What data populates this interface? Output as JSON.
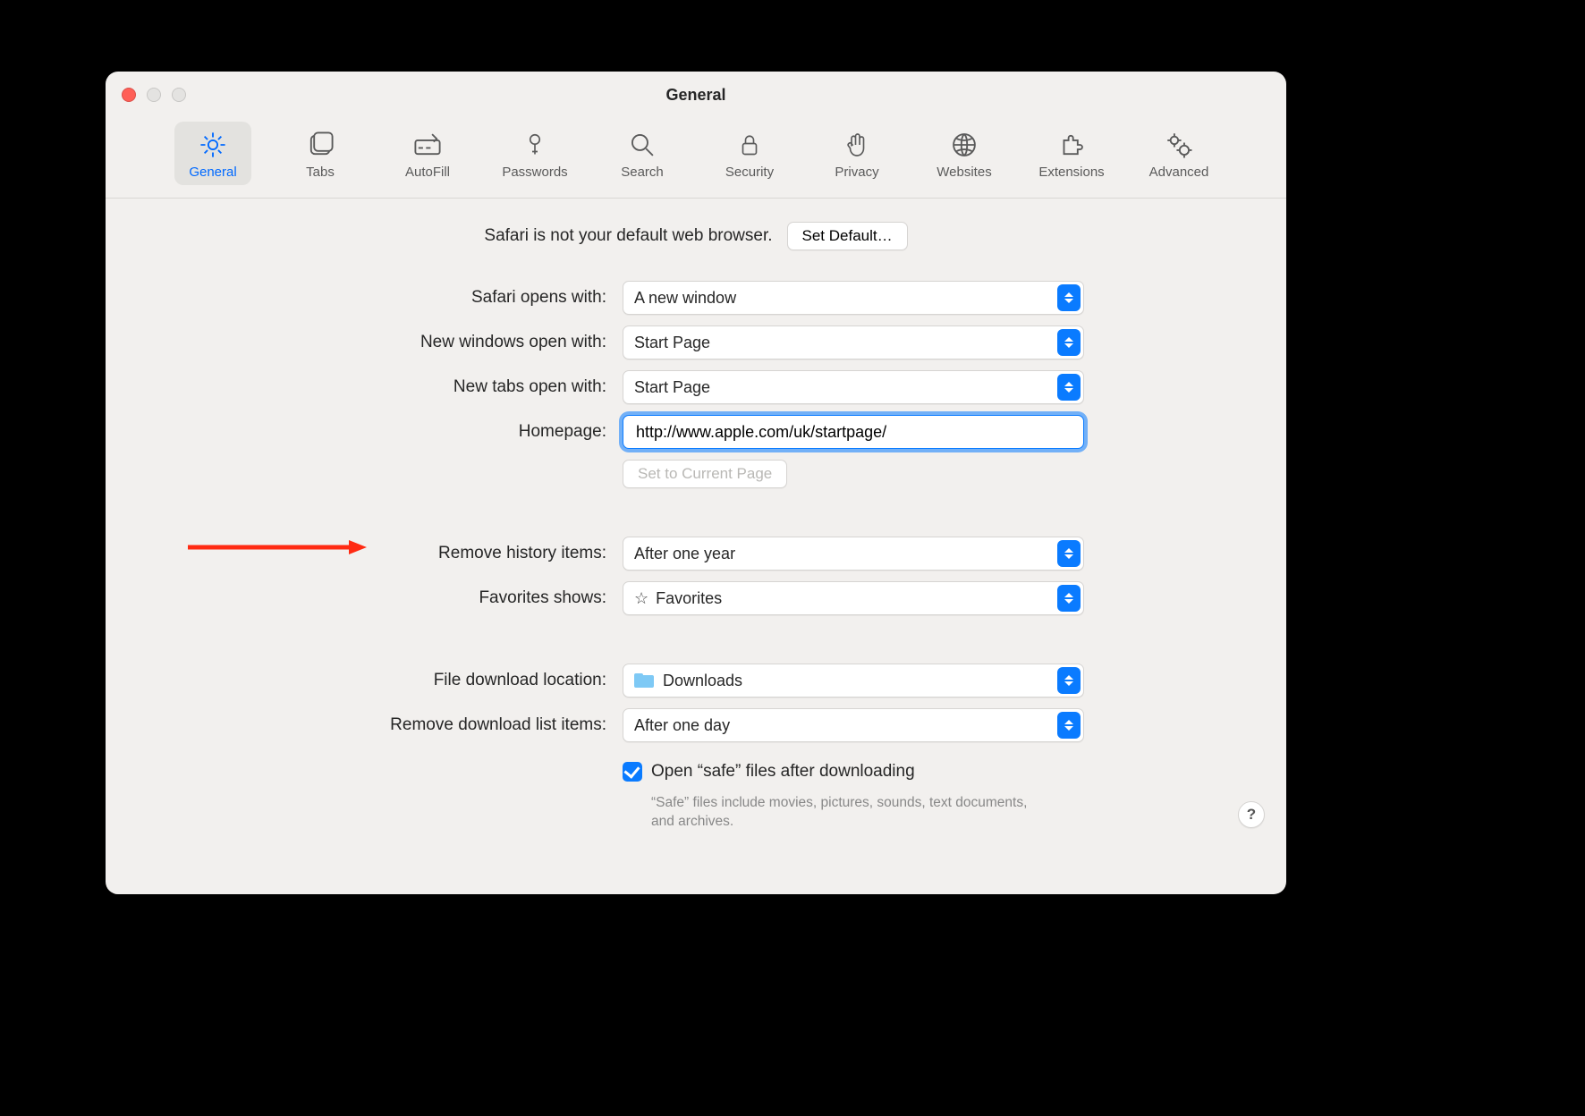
{
  "window": {
    "title": "General"
  },
  "tabs": {
    "general": "General",
    "tabs": "Tabs",
    "autofill": "AutoFill",
    "passwords": "Passwords",
    "search": "Search",
    "security": "Security",
    "privacy": "Privacy",
    "websites": "Websites",
    "extensions": "Extensions",
    "advanced": "Advanced"
  },
  "default_browser": {
    "message": "Safari is not your default web browser.",
    "button": "Set Default…"
  },
  "labels": {
    "opens_with": "Safari opens with:",
    "new_windows": "New windows open with:",
    "new_tabs": "New tabs open with:",
    "homepage": "Homepage:",
    "set_current": "Set to Current Page",
    "remove_history": "Remove history items:",
    "favorites_shows": "Favorites shows:",
    "download_loc": "File download location:",
    "remove_download": "Remove download list items:",
    "open_safe": "Open “safe” files after downloading",
    "safe_help": "“Safe” files include movies, pictures, sounds, text documents, and archives."
  },
  "values": {
    "opens_with": "A new window",
    "new_windows": "Start Page",
    "new_tabs": "Start Page",
    "homepage": "http://www.apple.com/uk/startpage/",
    "remove_history": "After one year",
    "favorites_shows": "Favorites",
    "download_loc": "Downloads",
    "remove_download": "After one day"
  },
  "helpbtn": "?"
}
